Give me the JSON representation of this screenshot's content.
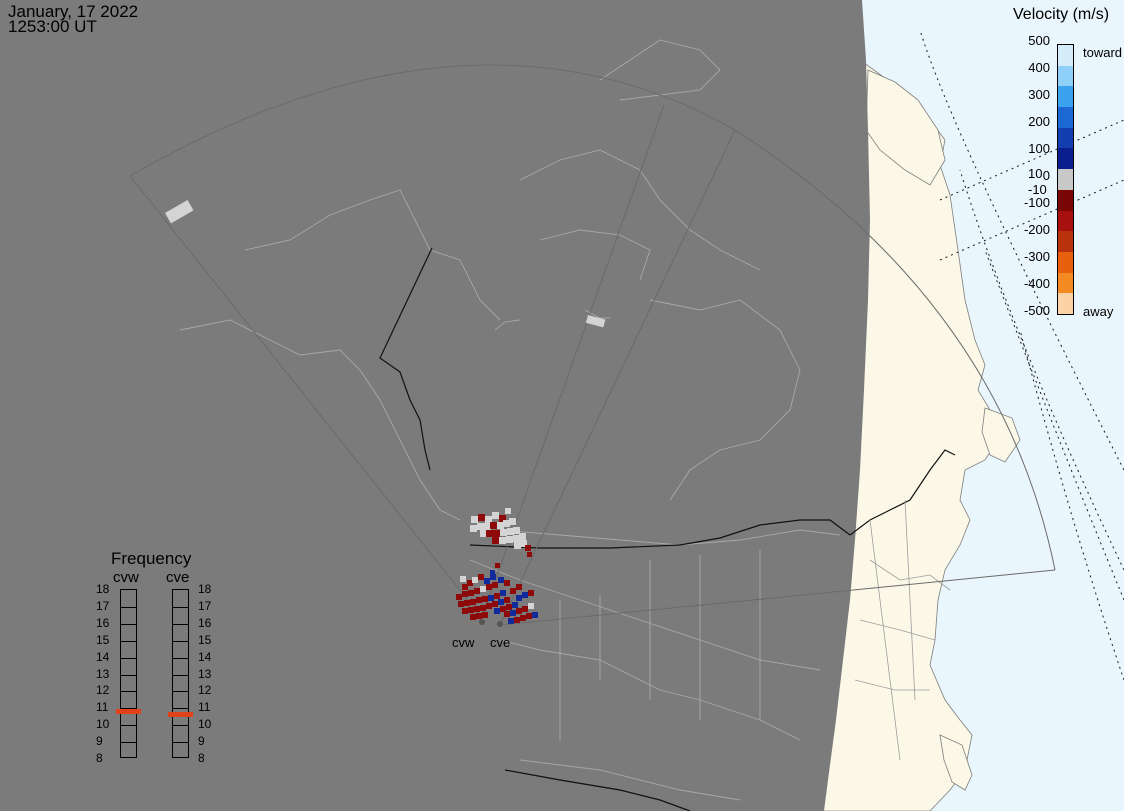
{
  "header": {
    "date": "January, 17 2022",
    "time": "1253:00 UT"
  },
  "velocity_scale": {
    "title": "Velocity (m/s)",
    "ticks": [
      "500",
      "400",
      "300",
      "200",
      "100",
      "0",
      "-100",
      "-200",
      "-300",
      "-400",
      "-500"
    ],
    "inner_pos": "10",
    "inner_neg": "-10",
    "end_top": "toward",
    "end_bottom": "away",
    "colors": [
      "#d7ecfb",
      "#8fd0f8",
      "#3aa2ee",
      "#1c69d4",
      "#123eb0",
      "#0a1e8e",
      "#c8c8c8",
      "#7a0606",
      "#a80f0f",
      "#b8330c",
      "#e8600d",
      "#f58a22",
      "#fbd3a6"
    ]
  },
  "frequency": {
    "title": "Frequency",
    "sites": [
      "cvw",
      "cve"
    ],
    "ticks": [
      "18",
      "17",
      "16",
      "15",
      "14",
      "13",
      "12",
      "11",
      "10",
      "9",
      "8"
    ],
    "cvw_value": 10.8,
    "cve_value": 10.6,
    "min": 8,
    "max": 18,
    "marker_color": "#e0421a"
  },
  "radars": {
    "cvw_label": "cvw",
    "cve_label": "cve"
  },
  "colors": {
    "night_shade": "#7b7b7b",
    "ocean": "#eaf6fd",
    "land_day": "#fbf8e8",
    "echo_red": "#8e0a0a",
    "echo_blue": "#102a9c",
    "echo_gray": "#d4d4d4"
  }
}
